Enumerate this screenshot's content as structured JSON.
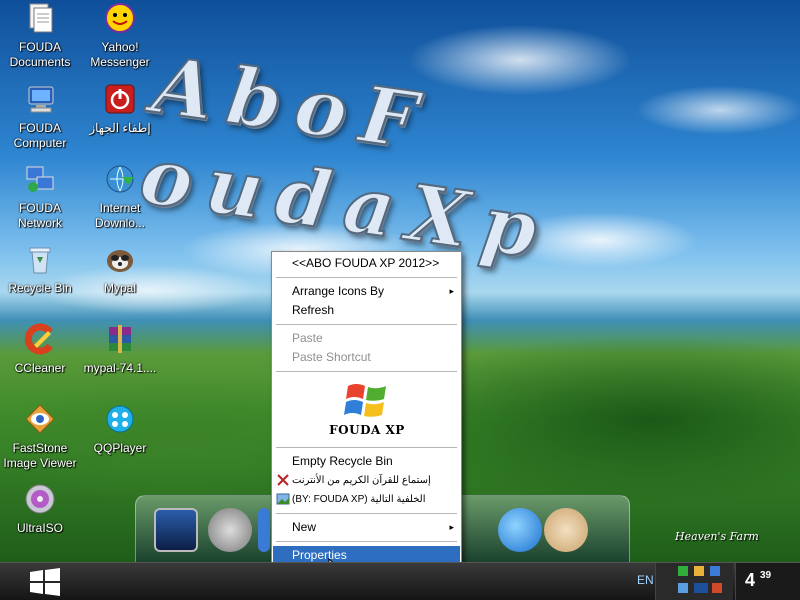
{
  "desktop": {
    "wallpaper_text": "AboF oudaXp",
    "wallpaper_caption": "Heaven's Farm",
    "icons": [
      {
        "label_line1": "FOUDA",
        "label_line2": "Documents",
        "icon": "documents-icon"
      },
      {
        "label_line1": "Yahoo!",
        "label_line2": "Messenger",
        "icon": "yahoo-messenger-icon"
      },
      {
        "label_line1": "FOUDA",
        "label_line2": "Computer",
        "icon": "computer-icon"
      },
      {
        "label_line1": "إطفاء الجهاز",
        "label_line2": "",
        "icon": "power-icon"
      },
      {
        "label_line1": "FOUDA",
        "label_line2": "Network",
        "icon": "network-icon"
      },
      {
        "label_line1": "Internet",
        "label_line2": "Downlo...",
        "icon": "internet-download-manager-icon"
      },
      {
        "label_line1": "Recycle Bin",
        "label_line2": "",
        "icon": "recycle-bin-icon"
      },
      {
        "label_line1": "Mypal",
        "label_line2": "",
        "icon": "mypal-icon"
      },
      {
        "label_line1": "CCleaner",
        "label_line2": "",
        "icon": "ccleaner-icon"
      },
      {
        "label_line1": "mypal-74.1....",
        "label_line2": "",
        "icon": "winrar-archive-icon"
      },
      {
        "label_line1": "FastStone",
        "label_line2": "Image Viewer",
        "icon": "faststone-icon"
      },
      {
        "label_line1": "QQPlayer",
        "label_line2": "",
        "icon": "qqplayer-icon"
      },
      {
        "label_line1": "UltraISO",
        "label_line2": "",
        "icon": "ultraiso-icon"
      }
    ]
  },
  "context_menu": {
    "header": "<<ABO FOUDA XP 2012>>",
    "arrange_icons_by": "Arrange Icons By",
    "refresh": "Refresh",
    "paste": "Paste",
    "paste_shortcut": "Paste Shortcut",
    "logo_caption": "FOUDA XP",
    "empty_recycle_bin": "Empty Recycle Bin",
    "quran_item": "إستماع للقرآن الكريم من الأنترنت",
    "next_wallpaper": "(BY: FOUDA XP) الخلفية التالية",
    "new": "New",
    "properties": "Properties",
    "submenu_arrow": "▸"
  },
  "taskbar": {
    "language": "EN",
    "clock_hour": "4",
    "clock_minutes": "39"
  },
  "colors": {
    "menu_highlight": "#2e6ec0",
    "taskbar": "#1a1a1a"
  }
}
